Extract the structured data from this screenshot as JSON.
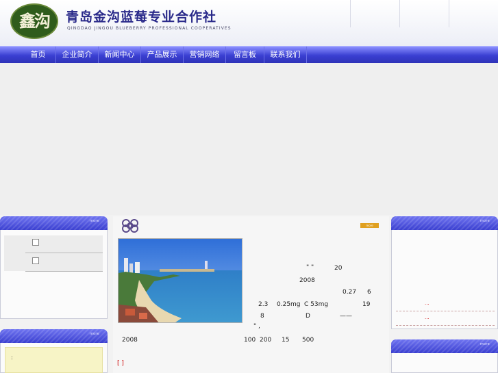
{
  "header": {
    "logo_text": "鑫沟",
    "title": "青岛金沟蓝莓专业合作社",
    "subtitle": "QINGDAO JINGOU BLUEBERRY PROFESSIONAL COOPERATIVES"
  },
  "nav": {
    "items": [
      "首页",
      "企业简介",
      "新闻中心",
      "产品展示",
      "营销网络",
      "留言板",
      "联系我们"
    ]
  },
  "left_panel_top": {
    "more": "more"
  },
  "left_panel_bottom": {
    "more": "more",
    "colon": ":"
  },
  "main": {
    "more": "more",
    "quote_mark": "\"     \"",
    "t_20": "20",
    "t_2008a": "2008",
    "t_027": "0.27",
    "t_6": "6",
    "t_23": "2.3",
    "t_025mg": "0.25mg",
    "t_c53mg": "C  53mg",
    "t_19": "19",
    "t_8": "8",
    "t_d": "D",
    "t_dash": "——",
    "t_quote2": "\"   ,",
    "t_2008b": "2008",
    "t_100": "100",
    "t_200": "200",
    "t_15": "15",
    "t_500": "500",
    "bracket": "[   ]"
  },
  "right_panel_top": {
    "more": "more",
    "ellipsis1": "...",
    "ellipsis2": "..."
  },
  "right_panel_bottom": {
    "more": "more"
  },
  "colors": {
    "nav": "#3a3fd2",
    "title": "#2a2a8a",
    "more_button": "#e0a020"
  },
  "icons": [
    "chain-logo-icon",
    "checkbox-icon"
  ]
}
